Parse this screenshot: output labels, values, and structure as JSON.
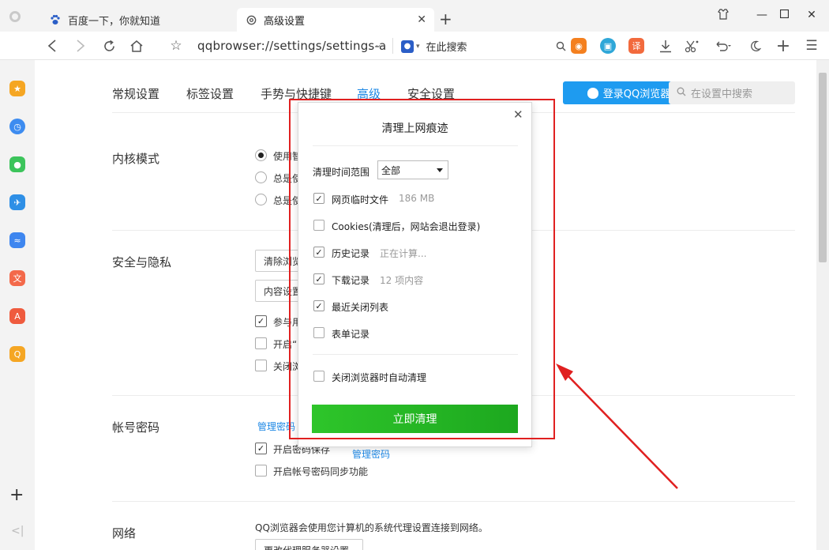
{
  "tabs": [
    {
      "title": "百度一下，你就知道",
      "icon": "baidu-paw-icon",
      "active": false
    },
    {
      "title": "高级设置",
      "icon": "gear-icon",
      "active": true
    }
  ],
  "toolbar": {
    "url": "qqbrowser://settings/settings-a",
    "search_engine_label": "在此搜索",
    "translate_badge": "译"
  },
  "nav": {
    "tabs": [
      "常规设置",
      "标签设置",
      "手势与快捷键",
      "高级",
      "安全设置"
    ],
    "active_index": 3,
    "login_label": "登录QQ浏览器",
    "search_placeholder": "在设置中搜索"
  },
  "sections": {
    "kernel": {
      "title": "内核模式",
      "options": [
        "使用智",
        "总是使",
        "总是使"
      ]
    },
    "privacy": {
      "title": "安全与隐私",
      "btn_clear": "清除浏览",
      "btn_content": "内容设置",
      "checks": [
        {
          "label": "参与用",
          "checked": true
        },
        {
          "label": "开启“",
          "checked": false
        },
        {
          "label": "关闭浏",
          "checked": false
        }
      ]
    },
    "account": {
      "title": "帐号密码",
      "manage_link": "管理密码",
      "checks": [
        {
          "label": "开启密码保存",
          "checked": true,
          "link": "管理密码"
        },
        {
          "label": "开启帐号密码同步功能",
          "checked": false
        }
      ]
    },
    "network": {
      "title": "网络",
      "desc": "QQ浏览器会使用您计算机的系统代理设置连接到网络。",
      "btn": "更改代理服务器设置"
    }
  },
  "dialog": {
    "title": "清理上网痕迹",
    "range_label": "清理时间范围",
    "range_value": "全部",
    "items": [
      {
        "label": "网页临时文件",
        "sub": "186 MB",
        "checked": true
      },
      {
        "label": "Cookies(清理后，网站会退出登录)",
        "sub": "",
        "checked": false
      },
      {
        "label": "历史记录",
        "sub": "正在计算...",
        "checked": true
      },
      {
        "label": "下载记录",
        "sub": "12 项内容",
        "checked": true
      },
      {
        "label": "最近关闭列表",
        "sub": "",
        "checked": true
      },
      {
        "label": "表单记录",
        "sub": "",
        "checked": false
      }
    ],
    "auto_clear": {
      "label": "关闭浏览器时自动清理",
      "checked": false
    },
    "clear_button": "立即清理"
  },
  "colors": {
    "accent": "#1e88e5",
    "login_blue": "#1e9bf0",
    "clear_green": "#22b525",
    "annotation_red": "#e02020"
  }
}
